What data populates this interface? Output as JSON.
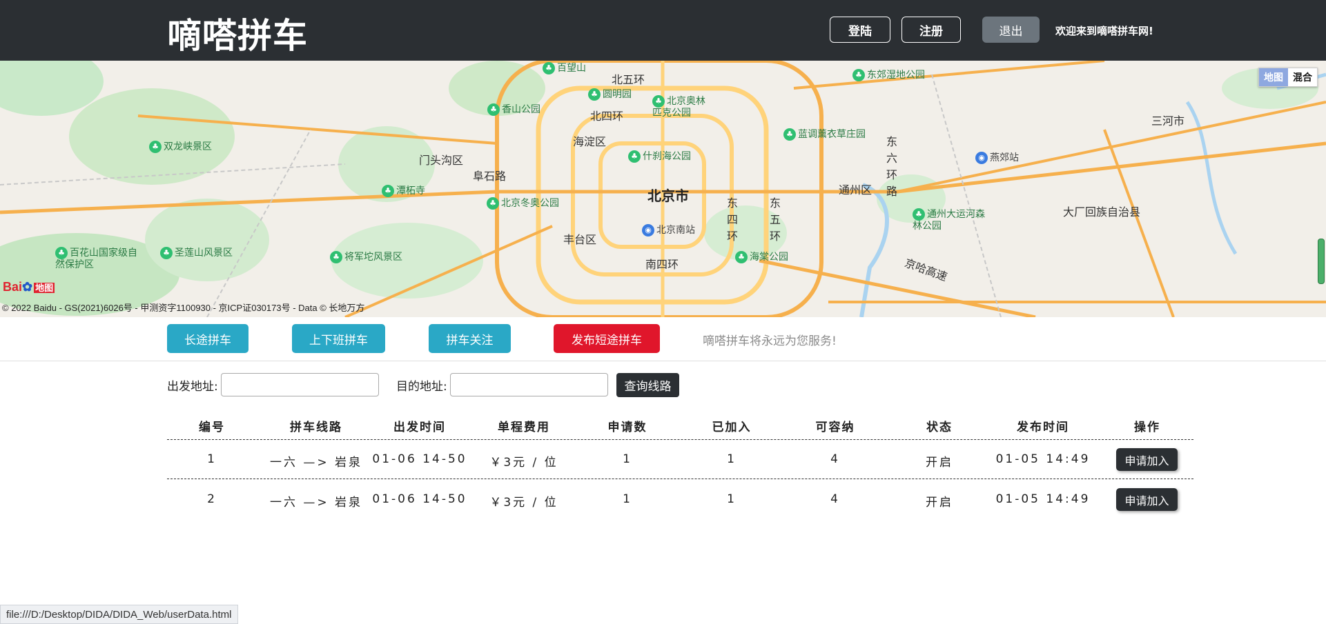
{
  "header": {
    "brand": "嘀嗒拼车",
    "login": "登陆",
    "register": "注册",
    "logout": "退出",
    "welcome": "欢迎来到嘀嗒拼车网!"
  },
  "map": {
    "labels": {
      "city": "北京市",
      "haidian": "海淀区",
      "fengtai": "丰台区",
      "tongzhou": "通州区",
      "mentougou": "门头沟区",
      "dachang": "大厂回族自治县",
      "sanhe": "三河市",
      "north5": "北五环",
      "north4": "北四环",
      "south4": "南四环",
      "east4": "东四环",
      "east5": "东五环",
      "east6": "东六环路",
      "jingha": "京哈高速",
      "fushilu": "阜石路",
      "bjsouth": "北京南站",
      "yanjiao": "燕郊站",
      "yuanmingyuan": "圆明园",
      "xiangshan": "香山公园",
      "shichahai": "什刹海公园",
      "olympic": "北京奥林匹克公园",
      "winter_olympic": "北京冬奥公园",
      "dongjiao": "东郊湿地公园",
      "lavender": "蓝调薰衣草庄园",
      "haitang": "海棠公园",
      "grand_canal": "通州大运河森林公园",
      "tanzhe": "潭柘寺",
      "shuanglong": "双龙峡景区",
      "shengliang": "圣莲山风景区",
      "baihua": "百花山国家级自然保护区",
      "jiangjun": "将军坨风景区",
      "baiwangshan": "百望山"
    },
    "map_type": [
      "地图",
      "混合"
    ],
    "copyright": "© 2022 Baidu - GS(2021)6026号 - 甲测资字1100930 - 京ICP证030173号 - Data © 长地万方",
    "logo_text": "Bai",
    "logo_suffix": "地图",
    "colors": {
      "road": "#ffd37a",
      "highway": "#f6b04d",
      "park": "#bfe7c3",
      "water": "#aad3f0"
    }
  },
  "nav": {
    "long": "长途拼车",
    "commute": "上下班拼车",
    "follow": "拼车关注",
    "publish": "发布短途拼车",
    "slogan": "嘀嗒拼车将永远为您服务!"
  },
  "search": {
    "from_label": "出发地址:",
    "from_value": "",
    "to_label": "目的地址:",
    "to_value": "",
    "button": "查询线路"
  },
  "table": {
    "headers": [
      "编号",
      "拼车线路",
      "出发时间",
      "单程费用",
      "申请数",
      "已加入",
      "可容纳",
      "状态",
      "发布时间",
      "操作"
    ],
    "rows": [
      {
        "id": "1",
        "route": "一六 —> 岩泉",
        "depart": "01-06 14-50",
        "fee": "￥3元 / 位",
        "applied": "1",
        "joined": "1",
        "capacity": "4",
        "status": "开启",
        "published": "01-05 14:49",
        "action": "申请加入"
      },
      {
        "id": "2",
        "route": "一六 —> 岩泉",
        "depart": "01-06 14-50",
        "fee": "￥3元 / 位",
        "applied": "1",
        "joined": "1",
        "capacity": "4",
        "status": "开启",
        "published": "01-05 14:49",
        "action": "申请加入"
      }
    ]
  },
  "status_bar": "file:///D:/Desktop/DIDA/DIDA_Web/userData.html"
}
